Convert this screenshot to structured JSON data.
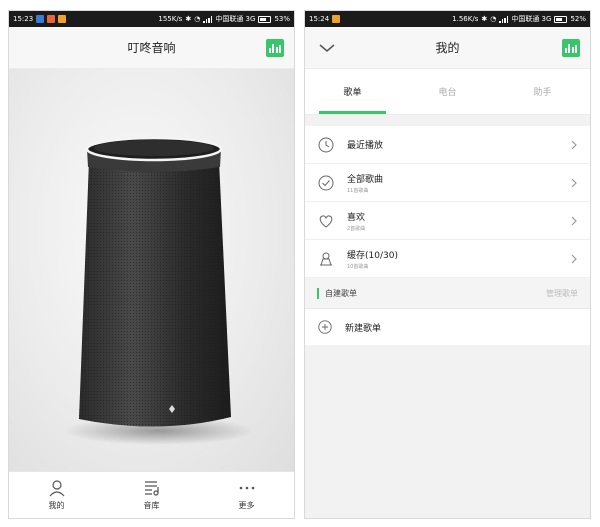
{
  "left": {
    "status": {
      "time": "15:23",
      "speed": "155K/s",
      "carrier": "中国联通 3G",
      "battery": "53%"
    },
    "title": "叮咚音响",
    "nav": [
      {
        "label": "我的",
        "icon": "person-icon"
      },
      {
        "label": "音库",
        "icon": "music-list-icon"
      },
      {
        "label": "更多",
        "icon": "more-dots-icon"
      }
    ]
  },
  "right": {
    "status": {
      "time": "15:24",
      "speed": "1.56K/s",
      "carrier": "中国联通 3G",
      "battery": "52%"
    },
    "title": "我的",
    "tabs": [
      {
        "label": "歌单",
        "active": true
      },
      {
        "label": "电台",
        "active": false
      },
      {
        "label": "助手",
        "active": false
      }
    ],
    "items": [
      {
        "label": "最近播放",
        "sub": "",
        "icon": "clock-icon"
      },
      {
        "label": "全部歌曲",
        "sub": "11首歌曲",
        "icon": "check-circle-icon"
      },
      {
        "label": "喜欢",
        "sub": "2首歌曲",
        "icon": "heart-icon"
      },
      {
        "label": "缓存(10/30)",
        "sub": "10首歌曲",
        "icon": "cache-icon"
      }
    ],
    "section": {
      "title": "自建歌单",
      "manage": "管理歌单"
    },
    "new_playlist": "新建歌单"
  },
  "colors": {
    "accent": "#37c76a",
    "statusbar": "#1b1b1b",
    "background": "#f2f2f2"
  }
}
